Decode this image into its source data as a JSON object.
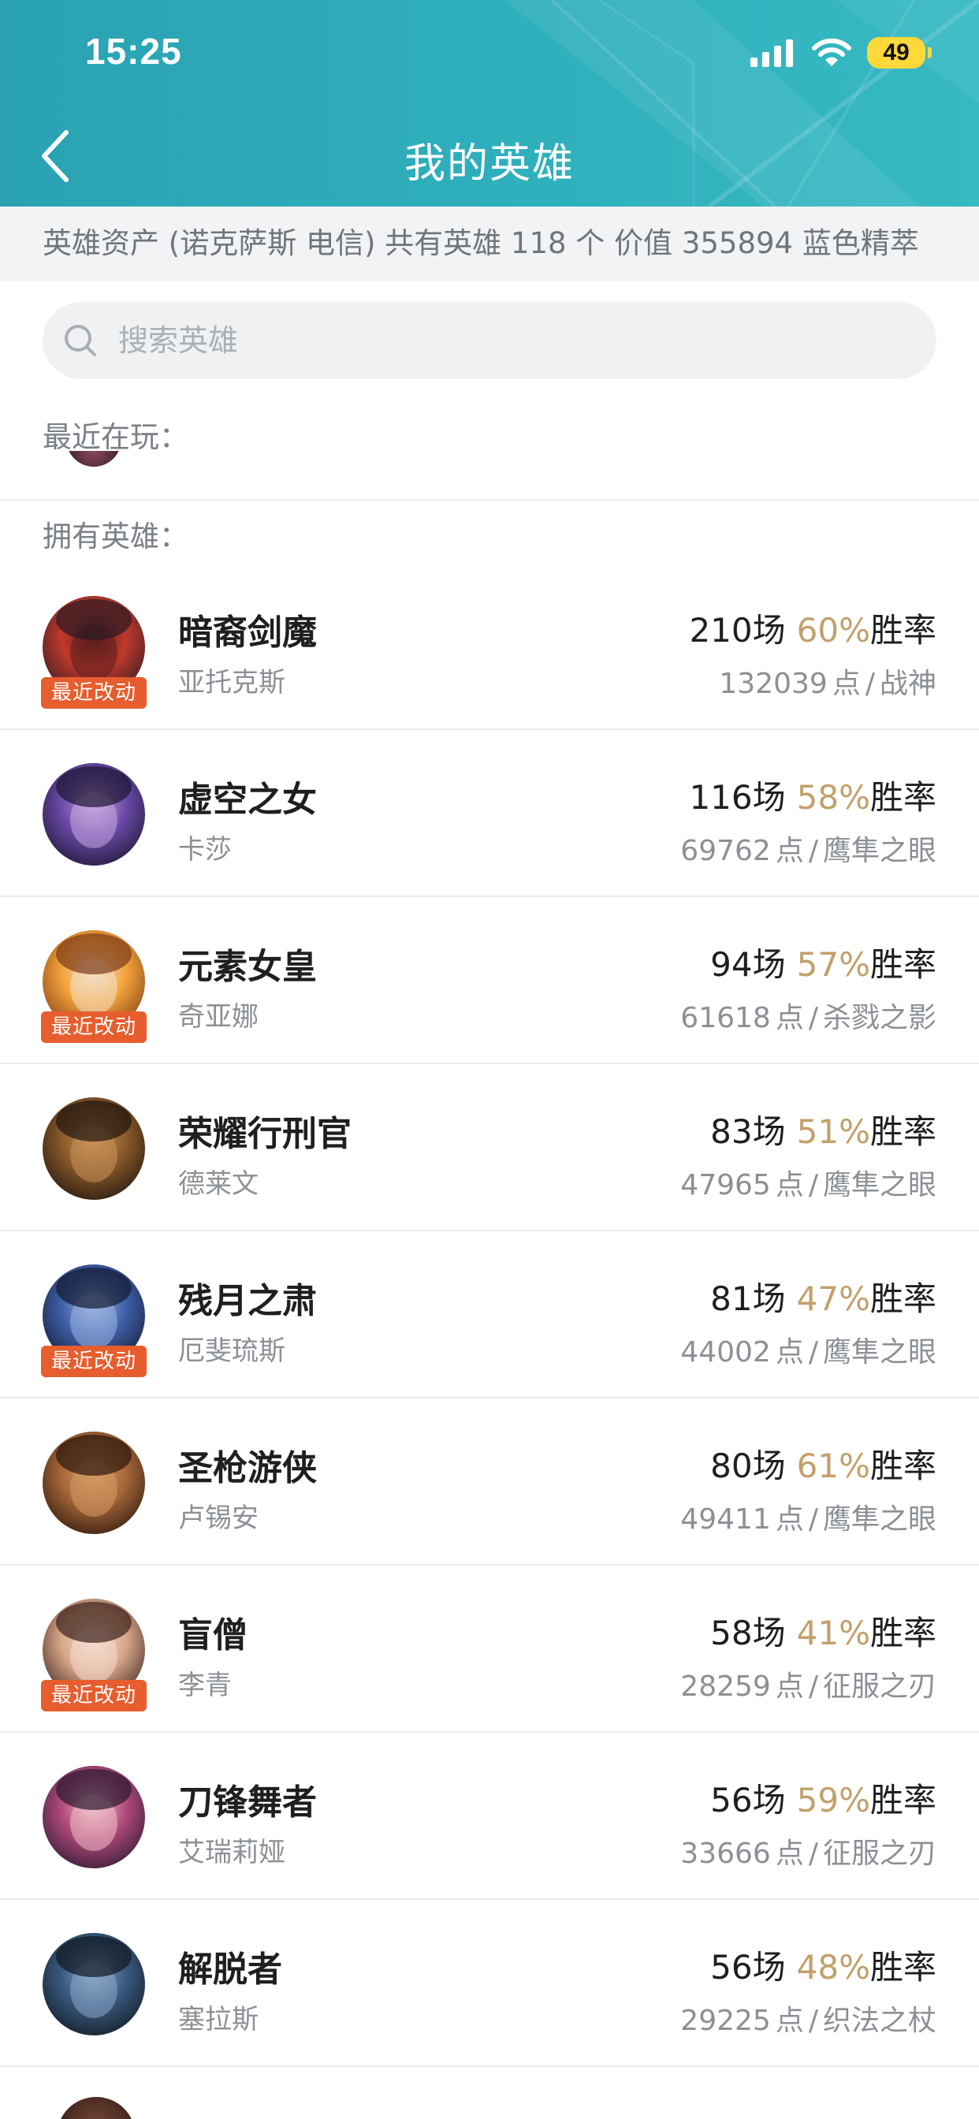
{
  "status_bar": {
    "time": "15:25",
    "battery": "49"
  },
  "header": {
    "title": "我的英雄",
    "back_icon": "chevron-left-icon"
  },
  "assets": {
    "text": "英雄资产 (诺克萨斯 电信)  共有英雄 118 个 价值 355894 蓝色精萃"
  },
  "search": {
    "placeholder": "搜索英雄",
    "value": "",
    "icon": "search-icon"
  },
  "recent": {
    "label": "最近在玩："
  },
  "owned": {
    "label": "拥有英雄："
  },
  "colors": {
    "header": "#2fb0bd",
    "rate": "#c2a06a",
    "badge": "#e65d2e"
  },
  "heroes": [
    {
      "title": "暗裔剑魔",
      "name": "亚托克斯",
      "games": "210",
      "games_unit": "场",
      "rate": "60%",
      "rate_unit": "胜率",
      "points": "132039",
      "points_unit": "点",
      "sep": "/",
      "rank": "战神",
      "badge": "最近改动",
      "has_badge": true
    },
    {
      "title": "虚空之女",
      "name": "卡莎",
      "games": "116",
      "games_unit": "场",
      "rate": "58%",
      "rate_unit": "胜率",
      "points": "69762",
      "points_unit": "点",
      "sep": "/",
      "rank": "鹰隼之眼",
      "badge": "",
      "has_badge": false
    },
    {
      "title": "元素女皇",
      "name": "奇亚娜",
      "games": "94",
      "games_unit": "场",
      "rate": "57%",
      "rate_unit": "胜率",
      "points": "61618",
      "points_unit": "点",
      "sep": "/",
      "rank": "杀戮之影",
      "badge": "最近改动",
      "has_badge": true
    },
    {
      "title": "荣耀行刑官",
      "name": "德莱文",
      "games": "83",
      "games_unit": "场",
      "rate": "51%",
      "rate_unit": "胜率",
      "points": "47965",
      "points_unit": "点",
      "sep": "/",
      "rank": "鹰隼之眼",
      "badge": "",
      "has_badge": false
    },
    {
      "title": "残月之肃",
      "name": "厄斐琉斯",
      "games": "81",
      "games_unit": "场",
      "rate": "47%",
      "rate_unit": "胜率",
      "points": "44002",
      "points_unit": "点",
      "sep": "/",
      "rank": "鹰隼之眼",
      "badge": "最近改动",
      "has_badge": true
    },
    {
      "title": "圣枪游侠",
      "name": "卢锡安",
      "games": "80",
      "games_unit": "场",
      "rate": "61%",
      "rate_unit": "胜率",
      "points": "49411",
      "points_unit": "点",
      "sep": "/",
      "rank": "鹰隼之眼",
      "badge": "",
      "has_badge": false
    },
    {
      "title": "盲僧",
      "name": "李青",
      "games": "58",
      "games_unit": "场",
      "rate": "41%",
      "rate_unit": "胜率",
      "points": "28259",
      "points_unit": "点",
      "sep": "/",
      "rank": "征服之刃",
      "badge": "最近改动",
      "has_badge": true
    },
    {
      "title": "刀锋舞者",
      "name": "艾瑞莉娅",
      "games": "56",
      "games_unit": "场",
      "rate": "59%",
      "rate_unit": "胜率",
      "points": "33666",
      "points_unit": "点",
      "sep": "/",
      "rank": "征服之刃",
      "badge": "",
      "has_badge": false
    },
    {
      "title": "解脱者",
      "name": "塞拉斯",
      "games": "56",
      "games_unit": "场",
      "rate": "48%",
      "rate_unit": "胜率",
      "points": "29225",
      "points_unit": "点",
      "sep": "/",
      "rank": "织法之杖",
      "badge": "",
      "has_badge": false
    }
  ]
}
